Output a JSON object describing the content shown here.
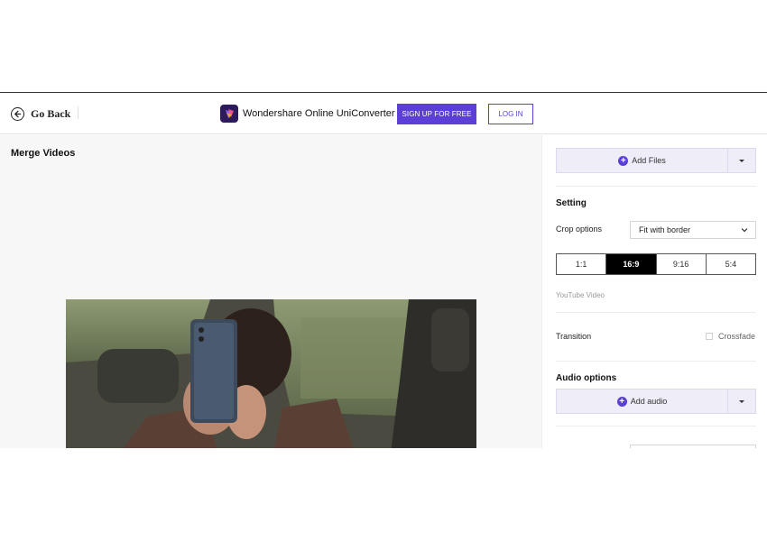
{
  "header": {
    "back_label": "Go Back",
    "brand_name": "Wondershare Online UniConverter",
    "signup_label": "SIGN UP FOR FREE",
    "login_label": "LOG IN"
  },
  "main": {
    "title": "Merge Videos"
  },
  "panel": {
    "add_files_label": "Add Files",
    "setting_title": "Setting",
    "crop_label": "Crop options",
    "crop_value": "Fit with border",
    "ratios": [
      "1:1",
      "16:9",
      "9:16",
      "5:4"
    ],
    "active_ratio": "16:9",
    "ratio_hint": "YouTube Video",
    "transition_label": "Transition",
    "crossfade_label": "Crossfade",
    "audio_title": "Audio options",
    "add_audio_label": "Add audio"
  },
  "colors": {
    "accent": "#5b3fd6",
    "brand_logo": "#2c1a5c"
  },
  "icons": {
    "back": "arrow-left-circle-icon",
    "brand": "uniconverter-logo-icon",
    "add": "plus-circle-icon",
    "dropdown": "caret-down-icon",
    "select": "chevron-down-icon"
  }
}
